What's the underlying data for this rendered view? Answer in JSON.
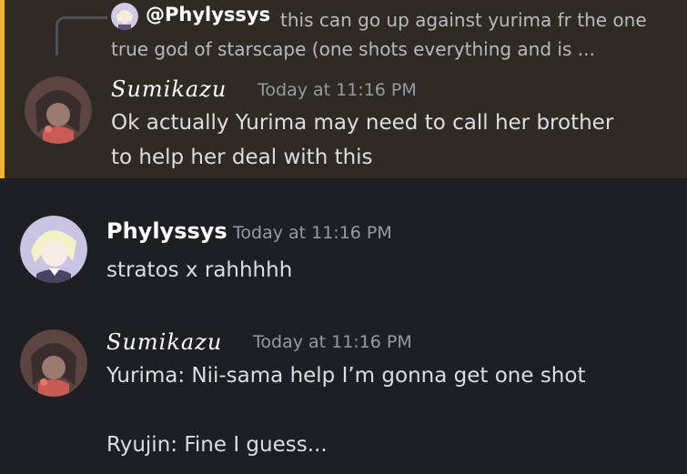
{
  "reply": {
    "author": "@Phylyssys",
    "text": "this can go up against yurima fr the one true god of starscape (one shots everything and is ..."
  },
  "messages": [
    {
      "author": "Sumikazu",
      "timestamp": "Today at 11:16 PM",
      "lines": [
        "Ok actually Yurima may need to call her brother",
        "to help her deal with this"
      ]
    },
    {
      "author": "Phylyssys",
      "timestamp": "Today at 11:16 PM",
      "lines": [
        "stratos x rahhhhh"
      ]
    },
    {
      "author": "Sumikazu",
      "timestamp": "Today at 11:16 PM",
      "lines": [
        "Yurima: Nii-sama help I’m gonna get one shot",
        "",
        "Ryujin: Fine I guess..."
      ]
    }
  ],
  "colors": {
    "background": "#1e1f22",
    "highlight": "#2f2b24",
    "highlight_border": "#f0b232",
    "timestamp": "#949ba4"
  }
}
